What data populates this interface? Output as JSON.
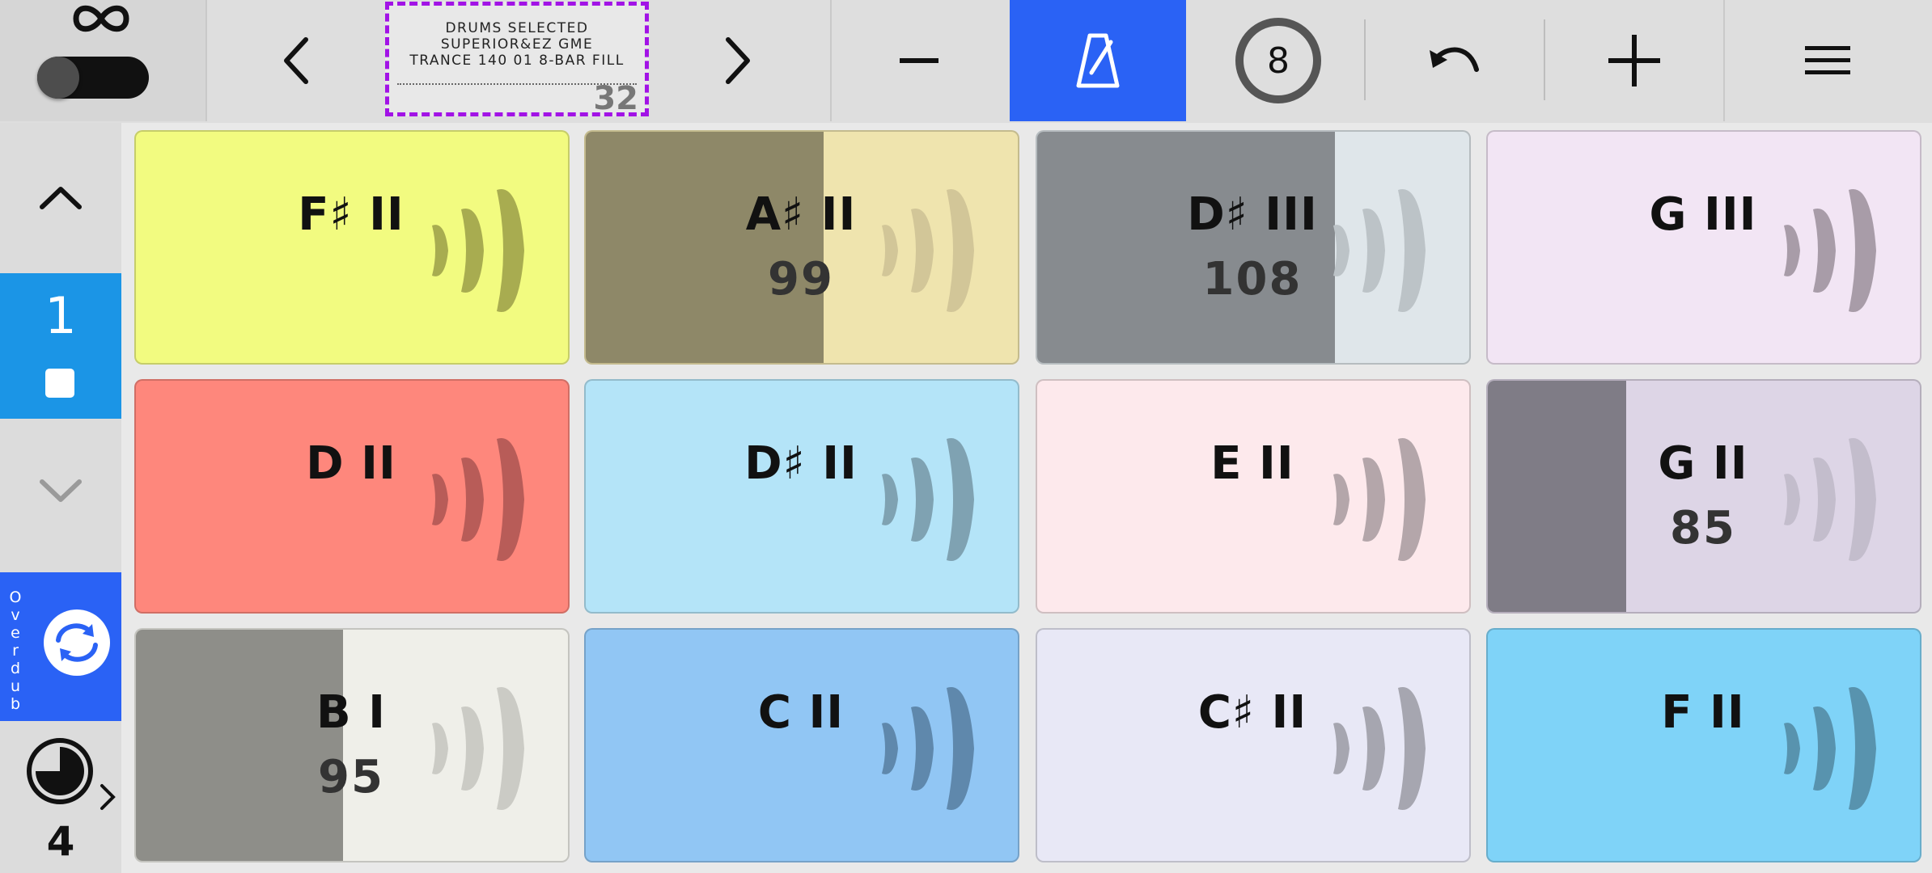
{
  "top_bar": {
    "sample": {
      "line1": "DRUMS SELECTED",
      "line2": "SUPERIOR&EZ GME",
      "line3": "TRANCE 140 01 8-BAR FILL",
      "length": "32"
    },
    "count_in": "8",
    "icons": [
      "infinity-icon",
      "toggle",
      "chevron-left-icon",
      "chevron-right-icon",
      "minus-icon",
      "metronome-icon",
      "undo-icon",
      "plus-icon",
      "menu-icon"
    ],
    "metronome_color": "#2a62f5"
  },
  "left_panel": {
    "bank_number": "1",
    "overdub_label": "Overdub",
    "timer_value": "4"
  },
  "pads": [
    {
      "note": "F♯ II",
      "value": "",
      "color": "#f2fb80",
      "fill_color": "",
      "fill": 0,
      "wave": "#a8ac50"
    },
    {
      "note": "A♯ II",
      "value": "99",
      "color": "#efe4ae",
      "fill_color": "#8e8868",
      "fill": 0.55,
      "wave": "#d2c698"
    },
    {
      "note": "D♯ III",
      "value": "108",
      "color": "#dfe6ea",
      "fill_color": "#878b8f",
      "fill": 0.69,
      "wave": "#bcc3c7"
    },
    {
      "note": "G III",
      "value": "",
      "color": "#f2e5f4",
      "fill_color": "",
      "fill": 0,
      "wave": "#a89ca8"
    },
    {
      "note": "D II",
      "value": "",
      "color": "#fe877c",
      "fill_color": "",
      "fill": 0,
      "wave": "#b85c58"
    },
    {
      "note": "D♯ II",
      "value": "",
      "color": "#b4e4f8",
      "fill_color": "",
      "fill": 0,
      "wave": "#7fa2b2"
    },
    {
      "note": "E II",
      "value": "",
      "color": "#fde9ec",
      "fill_color": "",
      "fill": 0,
      "wave": "#b4a6aa"
    },
    {
      "note": "G II",
      "value": "85",
      "color": "#ddd5e6",
      "fill_color": "#7f7c86",
      "fill": 0.32,
      "wave": "#c3bdcc"
    },
    {
      "note": "B I",
      "value": "95",
      "color": "#efefe9",
      "fill_color": "#8e8e89",
      "fill": 0.48,
      "wave": "#cbcbc5"
    },
    {
      "note": "C II",
      "value": "",
      "color": "#91c6f4",
      "fill_color": "",
      "fill": 0,
      "wave": "#5f88ac"
    },
    {
      "note": "C♯ II",
      "value": "",
      "color": "#e8e8f6",
      "fill_color": "",
      "fill": 0,
      "wave": "#a6a6b0"
    },
    {
      "note": "F II",
      "value": "",
      "color": "#7fd3f8",
      "fill_color": "",
      "fill": 0,
      "wave": "#5893ae"
    }
  ]
}
